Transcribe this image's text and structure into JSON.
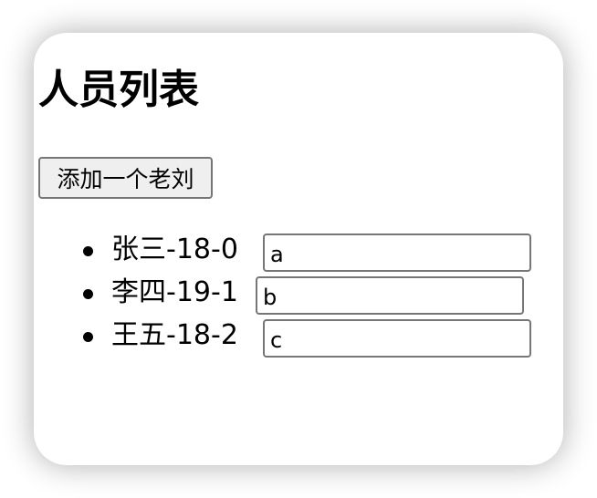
{
  "page": {
    "title": "人员列表",
    "add_button_label": "添加一个老刘"
  },
  "persons": [
    {
      "label": "张三-18-0",
      "input_value": "a"
    },
    {
      "label": "李四-19-1",
      "input_value": "b"
    },
    {
      "label": "王五-18-2",
      "input_value": "c"
    }
  ]
}
